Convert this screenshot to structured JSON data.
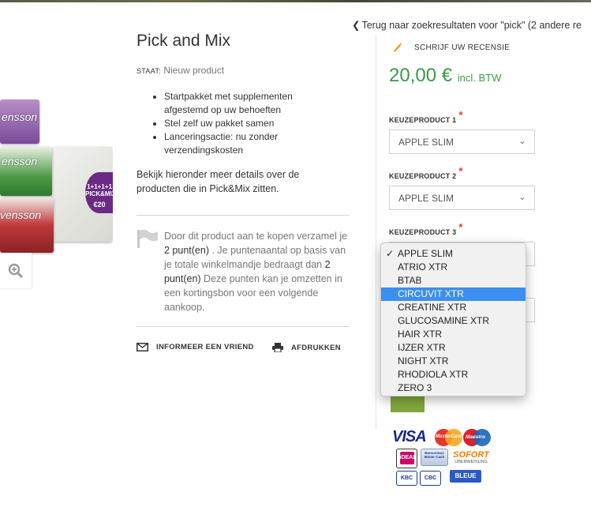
{
  "product": {
    "title": "Pick and Mix",
    "condition_label": "STAAT:",
    "condition_value": "Nieuw product",
    "features": [
      "Startpakket met supplementen afgestemd op uw behoeften",
      "Stel zelf uw pakket samen",
      "Lanceringsactie: nu zonder verzendingskosten"
    ],
    "details_text": "Bekijk hieronder meer details over de producten die in Pick&Mix zitten.",
    "image_texts": {
      "brand_1": "ensson",
      "brand_2": "ensson",
      "brand_3": "vensson",
      "badge_line_1": "1+1+1+1",
      "badge_line_2": "PICK&MIX",
      "badge_price": "€20"
    }
  },
  "points": {
    "text_1": "Door dit product aan te kopen verzamel je ",
    "value_1": "2 punt(en)",
    "text_2": " . Je puntenaantal op basis van je totale winkelmandje bedraagt dan ",
    "value_2": "2 punt(en)",
    "text_3": " Deze punten kan je omzetten in een kortingsbon voor een volgende aankoop."
  },
  "actions": {
    "tell_friend": "INFORMEER EEN VRIEND",
    "print": "AFDRUKKEN"
  },
  "back_link": "Terug naar zoekresultaten voor \"pick\" (2 andere re",
  "review_link": "SCHRIJF UW RECENSIE",
  "price": {
    "amount": "20,00 €",
    "tax": "incl. BTW"
  },
  "choices": [
    {
      "label": "KEUZEPRODUCT 1",
      "value": "APPLE SLIM"
    },
    {
      "label": "KEUZEPRODUCT 2",
      "value": "APPLE SLIM"
    },
    {
      "label": "KEUZEPRODUCT 3",
      "value": ""
    }
  ],
  "required_mark": "*",
  "dropdown": {
    "checked": "APPLE SLIM",
    "highlighted": "CIRCUVIT XTR",
    "options": [
      "APPLE SLIM",
      "ATRIO XTR",
      "BTAB",
      "CIRCUVIT XTR",
      "CREATINE XTR",
      "GLUCOSAMINE XTR",
      "HAIR XTR",
      "IJZER XTR",
      "NIGHT XTR",
      "RHODIOLA XTR",
      "ZERO 3"
    ]
  },
  "payment_logos": {
    "visa": "VISA",
    "mastercard": "MasterCard",
    "maestro": "Maestro",
    "ideal": "iDEAL",
    "bancontact": "Bancontact Mister Cash",
    "sofort": "SOFORT",
    "sofort_sub": "ÜBERWEISUNG",
    "kbc": "KBC",
    "cbc": "CBC",
    "belfius": "BLEUE"
  },
  "colors": {
    "price_green": "#3a9a45",
    "button_green": "#82a83c",
    "highlight_blue": "#3b8ff0",
    "required_red": "#e53935",
    "pencil_orange": "#f0a030"
  }
}
